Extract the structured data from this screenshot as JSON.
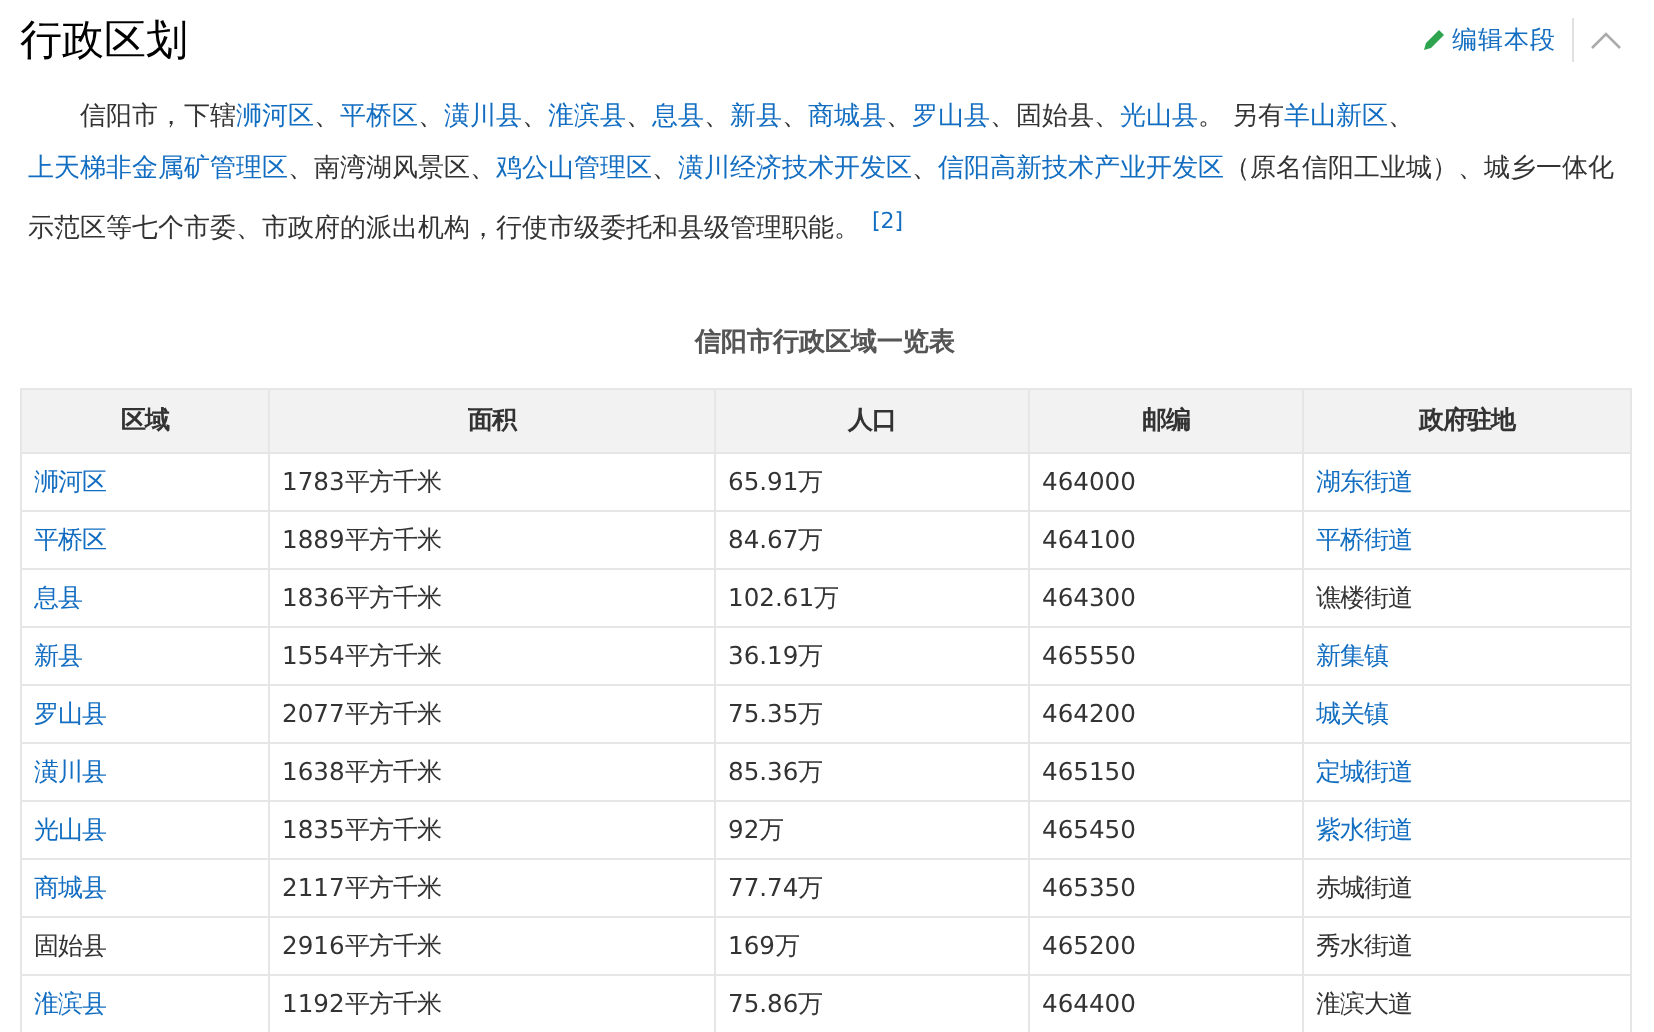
{
  "section": {
    "title": "行政区划",
    "edit_button": "编辑本段",
    "collapsed": false
  },
  "paragraph": {
    "segments": [
      {
        "text": "信阳市，下辖",
        "link": false
      },
      {
        "text": "浉河区",
        "link": true
      },
      {
        "text": "、",
        "link": false
      },
      {
        "text": "平桥区",
        "link": true
      },
      {
        "text": "、",
        "link": false
      },
      {
        "text": "潢川县",
        "link": true
      },
      {
        "text": "、",
        "link": false
      },
      {
        "text": "淮滨县",
        "link": true
      },
      {
        "text": "、",
        "link": false
      },
      {
        "text": "息县",
        "link": true
      },
      {
        "text": "、",
        "link": false
      },
      {
        "text": "新县",
        "link": true
      },
      {
        "text": "、",
        "link": false
      },
      {
        "text": "商城县",
        "link": true
      },
      {
        "text": "、",
        "link": false
      },
      {
        "text": "罗山县",
        "link": true
      },
      {
        "text": "、固始县、",
        "link": false
      },
      {
        "text": "光山县",
        "link": true
      },
      {
        "text": "。 另有",
        "link": false
      },
      {
        "text": "羊山新区",
        "link": true
      },
      {
        "text": "、",
        "link": false
      },
      {
        "text": "上天梯非金属矿管理区",
        "link": true
      },
      {
        "text": "、南湾湖风景区、",
        "link": false
      },
      {
        "text": "鸡公山管理区",
        "link": true
      },
      {
        "text": "、",
        "link": false
      },
      {
        "text": "潢川经济技术开发区",
        "link": true
      },
      {
        "text": "、",
        "link": false
      },
      {
        "text": "信阳高新技术产业开发区",
        "link": true
      },
      {
        "text": "（原名信阳工业城）、城乡一体化示范区等七个市委、市政府的派出机构，行使市级委托和县级管理职能。",
        "link": false
      }
    ],
    "footnote": "[2]"
  },
  "table": {
    "caption": "信阳市行政区域一览表",
    "columns": [
      "区域",
      "面积",
      "人口",
      "邮编",
      "政府驻地"
    ],
    "rows": [
      [
        {
          "text": "浉河区",
          "link": true
        },
        {
          "text": "1783平方千米",
          "link": false
        },
        {
          "text": "65.91万",
          "link": false
        },
        {
          "text": "464000",
          "link": false
        },
        {
          "text": "湖东街道",
          "link": true
        }
      ],
      [
        {
          "text": "平桥区",
          "link": true
        },
        {
          "text": "1889平方千米",
          "link": false
        },
        {
          "text": "84.67万",
          "link": false
        },
        {
          "text": "464100",
          "link": false
        },
        {
          "text": "平桥街道",
          "link": true
        }
      ],
      [
        {
          "text": "息县",
          "link": true
        },
        {
          "text": "1836平方千米",
          "link": false
        },
        {
          "text": "102.61万",
          "link": false
        },
        {
          "text": "464300",
          "link": false
        },
        {
          "text": "谯楼街道",
          "link": false
        }
      ],
      [
        {
          "text": "新县",
          "link": true
        },
        {
          "text": "1554平方千米",
          "link": false
        },
        {
          "text": "36.19万",
          "link": false
        },
        {
          "text": "465550",
          "link": false
        },
        {
          "text": "新集镇",
          "link": true
        }
      ],
      [
        {
          "text": "罗山县",
          "link": true
        },
        {
          "text": "2077平方千米",
          "link": false
        },
        {
          "text": "75.35万",
          "link": false
        },
        {
          "text": "464200",
          "link": false
        },
        {
          "text": "城关镇",
          "link": true
        }
      ],
      [
        {
          "text": "潢川县",
          "link": true
        },
        {
          "text": "1638平方千米",
          "link": false
        },
        {
          "text": "85.36万",
          "link": false
        },
        {
          "text": "465150",
          "link": false
        },
        {
          "text": "定城街道",
          "link": true
        }
      ],
      [
        {
          "text": "光山县",
          "link": true
        },
        {
          "text": "1835平方千米",
          "link": false
        },
        {
          "text": "92万",
          "link": false
        },
        {
          "text": "465450",
          "link": false
        },
        {
          "text": "紫水街道",
          "link": true
        }
      ],
      [
        {
          "text": "商城县",
          "link": true
        },
        {
          "text": "2117平方千米",
          "link": false
        },
        {
          "text": "77.74万",
          "link": false
        },
        {
          "text": "465350",
          "link": false
        },
        {
          "text": "赤城街道",
          "link": false
        }
      ],
      [
        {
          "text": "固始县",
          "link": false
        },
        {
          "text": "2916平方千米",
          "link": false
        },
        {
          "text": "169万",
          "link": false
        },
        {
          "text": "465200",
          "link": false
        },
        {
          "text": "秀水街道",
          "link": false
        }
      ],
      [
        {
          "text": "淮滨县",
          "link": true
        },
        {
          "text": "1192平方千米",
          "link": false
        },
        {
          "text": "75.86万",
          "link": false
        },
        {
          "text": "464400",
          "link": false
        },
        {
          "text": "淮滨大道",
          "link": false
        }
      ]
    ]
  }
}
